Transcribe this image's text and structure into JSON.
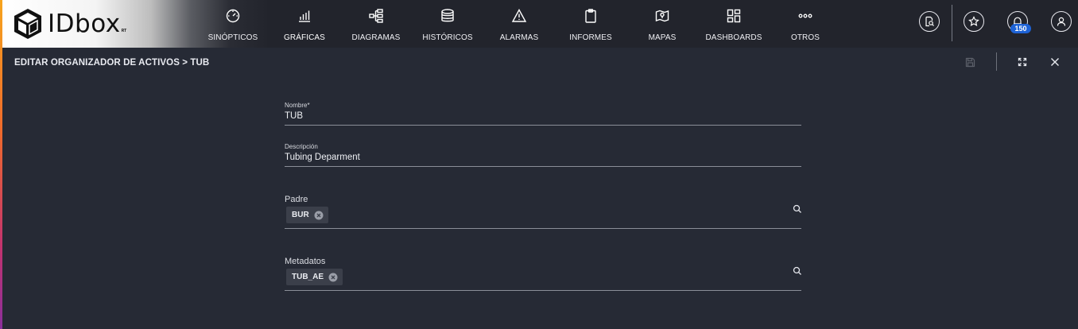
{
  "brand": {
    "name": "IDbox",
    "suffix": "RT"
  },
  "nav": [
    {
      "label": "SINÓPTICOS",
      "icon": "speedometer-icon"
    },
    {
      "label": "GRÁFICAS",
      "icon": "bar-chart-icon"
    },
    {
      "label": "DIAGRAMAS",
      "icon": "tree-diagram-icon"
    },
    {
      "label": "HISTÓRICOS",
      "icon": "database-icon"
    },
    {
      "label": "ALARMAS",
      "icon": "warning-icon"
    },
    {
      "label": "INFORMES",
      "icon": "clipboard-icon"
    },
    {
      "label": "MAPAS",
      "icon": "map-icon"
    },
    {
      "label": "DASHBOARDS",
      "icon": "dashboard-grid-icon"
    },
    {
      "label": "OTROS",
      "icon": "more-dots-icon"
    }
  ],
  "header_actions": {
    "notifications_count": "150"
  },
  "page": {
    "title": "EDITAR ORGANIZADOR DE ACTIVOS > TUB"
  },
  "form": {
    "nombre": {
      "label": "Nombre*",
      "value": "TUB"
    },
    "descripcion": {
      "label": "Descripción",
      "value": "Tubing Deparment"
    },
    "padre": {
      "label": "Padre",
      "chips": [
        "BUR"
      ]
    },
    "metadatos": {
      "label": "Metadatos",
      "chips": [
        "TUB_AE"
      ]
    }
  },
  "colors": {
    "background": "#262a35",
    "topbar": "#22242c",
    "badge": "#1e63d6",
    "chip": "#3b3f4a"
  }
}
